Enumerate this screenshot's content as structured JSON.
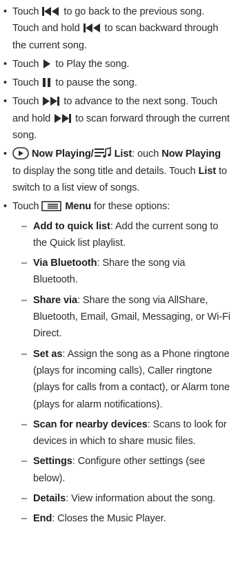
{
  "items": [
    {
      "pre": "Touch ",
      "icon": "previous-icon",
      "text": " to go back to the previous song. Touch and hold ",
      "icon2": "previous-icon",
      "post": " to scan backward through the current song."
    },
    {
      "pre": "Touch ",
      "icon": "play-icon",
      "post": " to Play the song."
    },
    {
      "pre": "Touch ",
      "icon": "pause-icon",
      "post": " to pause the song."
    },
    {
      "pre": "Touch ",
      "icon": "next-icon",
      "text": " to advance to the next song. Touch and hold ",
      "icon2": "next-icon",
      "post": " to scan forward through the current song."
    }
  ],
  "now_playing": {
    "label": "Now Playing/",
    "list_label": "List",
    "colon": ": ouch ",
    "b1": "Now Playing",
    "t1": " to display the song title and details. Touch ",
    "b2": "List",
    "t2": " to switch to a list view of songs."
  },
  "menu": {
    "pre": "Touch ",
    "label": "Menu",
    "post": " for these options:",
    "options": [
      {
        "title": "Add to quick list",
        "desc": ": Add the current song to the Quick list playlist."
      },
      {
        "title": "Via Bluetooth",
        "desc": ": Share the song via Bluetooth."
      },
      {
        "title": "Share via",
        "desc": ": Share the song via AllShare, Bluetooth, Email, Gmail, Messaging, or Wi-Fi Direct."
      },
      {
        "title": "Set as",
        "desc": ": Assign the song as a Phone ringtone (plays for incoming calls), Caller ringtone (plays for calls from a contact), or Alarm tone (plays for alarm notifications)."
      },
      {
        "title": "Scan for nearby devices",
        "desc": ": Scans to look for devices in which to share music files."
      },
      {
        "title": "Settings",
        "desc": ": Configure other settings (see below)."
      },
      {
        "title": "Details",
        "desc": ": View information about the song."
      },
      {
        "title": "End",
        "desc": ": Closes the Music Player."
      }
    ]
  },
  "glyphs": {
    "bullet": "•",
    "dash": "–"
  }
}
